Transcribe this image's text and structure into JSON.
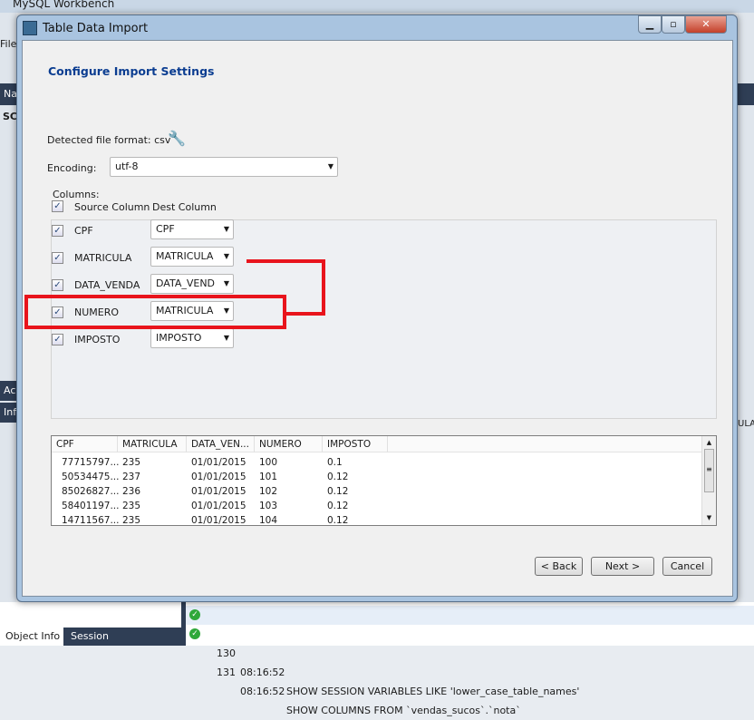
{
  "background": {
    "app_title": "MySQL Workbench",
    "menu_file": "File",
    "nav_label": "Na",
    "schema_label": "SC",
    "action_label": "Ac",
    "info_label": "Inf",
    "right_fragment": "ULA",
    "bottom_tabs": [
      "Object Info",
      "Session"
    ],
    "log": [
      {
        "num": "130",
        "time": "08:16:52",
        "query": "SHOW SESSION VARIABLES LIKE 'lower_case_table_names'"
      },
      {
        "num": "131",
        "time": "08:16:52",
        "query": "SHOW COLUMNS FROM `vendas_sucos`.`nota`"
      }
    ]
  },
  "dialog": {
    "title": "Table Data Import",
    "heading": "Configure Import Settings",
    "detected_format_label": "Detected file format: csv",
    "encoding_label": "Encoding:",
    "encoding_value": "utf-8",
    "columns_label": "Columns:",
    "source_header": "Source Column",
    "dest_header": "Dest Column",
    "columns": [
      {
        "source": "CPF",
        "dest": "CPF",
        "checked": true
      },
      {
        "source": "MATRICULA",
        "dest": "MATRICULA",
        "checked": true
      },
      {
        "source": "DATA_VENDA",
        "dest": "DATA_VEND",
        "checked": true
      },
      {
        "source": "NUMERO",
        "dest": "MATRICULA",
        "checked": true
      },
      {
        "source": "IMPOSTO",
        "dest": "IMPOSTO",
        "checked": true
      }
    ],
    "preview": {
      "headers": [
        "CPF",
        "MATRICULA",
        "DATA_VEN...",
        "NUMERO",
        "IMPOSTO"
      ],
      "rows": [
        [
          "77715797...",
          "235",
          "01/01/2015",
          "100",
          "0.1"
        ],
        [
          "50534475...",
          "237",
          "01/01/2015",
          "101",
          "0.12"
        ],
        [
          "85026827...",
          "236",
          "01/01/2015",
          "102",
          "0.12"
        ],
        [
          "58401197...",
          "235",
          "01/01/2015",
          "103",
          "0.12"
        ],
        [
          "14711567...",
          "235",
          "01/01/2015",
          "104",
          "0.12"
        ]
      ]
    },
    "buttons": {
      "back": "< Back",
      "next": "Next >",
      "cancel": "Cancel"
    },
    "annotation_color": "#e8141c"
  }
}
